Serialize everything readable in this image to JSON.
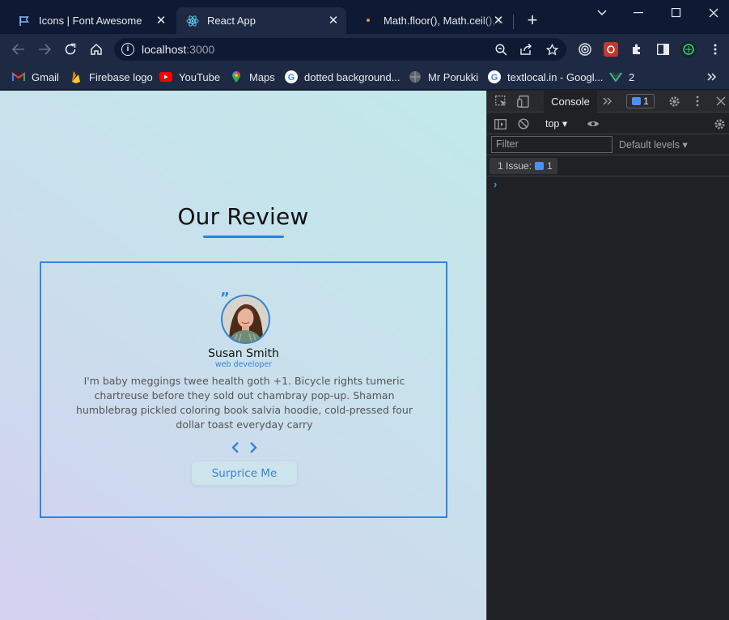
{
  "tabs": [
    {
      "title": "Icons | Font Awesome",
      "favicon": "flag-icon"
    },
    {
      "title": "React App",
      "favicon": "react-icon"
    },
    {
      "title": "Math.floor(), Math.ceil(), Ma",
      "favicon": "dot-icon"
    }
  ],
  "address": {
    "host": "localhost",
    "port": ":3000"
  },
  "bookmarks": [
    {
      "label": "Gmail"
    },
    {
      "label": "Firebase logo"
    },
    {
      "label": "YouTube"
    },
    {
      "label": "Maps"
    },
    {
      "label": "dotted background..."
    },
    {
      "label": "Mr Porukki"
    },
    {
      "label": "textlocal.in - Googl..."
    },
    {
      "label": "2"
    }
  ],
  "page": {
    "heading": "Our Review",
    "review": {
      "name": "Susan Smith",
      "job": "web developer",
      "text": "I'm baby meggings twee health goth +1. Bicycle rights tumeric chartreuse before they sold out chambray pop-up. Shaman humblebrag pickled coloring book salvia hoodie, cold-pressed four dollar toast everyday carry",
      "button": "Surprice Me"
    }
  },
  "devtools": {
    "active_tab": "Console",
    "issues_badge": "1",
    "context": "top",
    "filter_placeholder": "Filter",
    "levels": "Default levels",
    "issues_label": "1 Issue:",
    "issues_count": "1"
  },
  "colors": {
    "accent": "#3584d6",
    "frame": "#0e1a33",
    "toolbar": "#1e2a44"
  }
}
